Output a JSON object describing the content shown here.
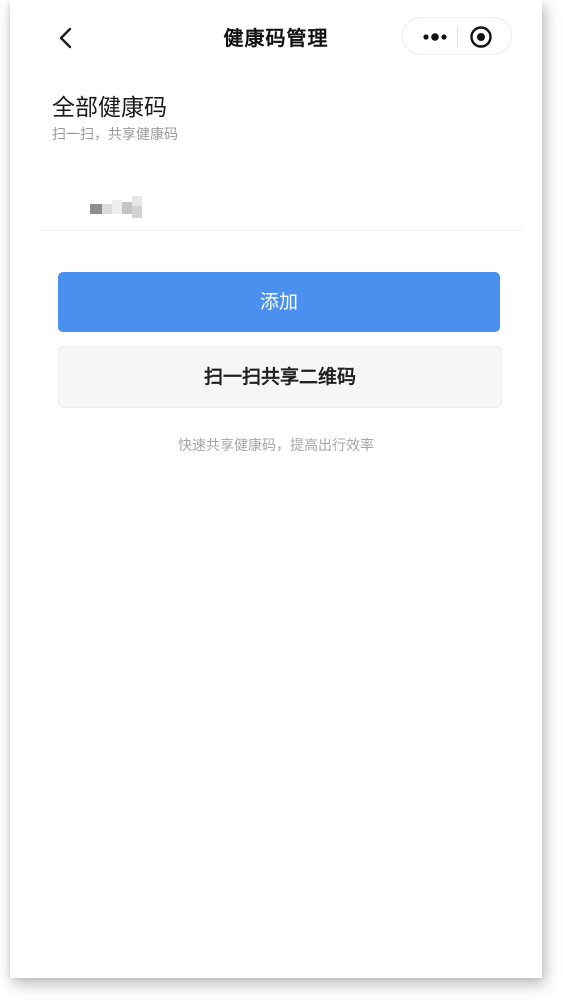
{
  "nav": {
    "title": "健康码管理",
    "back_icon": "chevron-left-icon",
    "more_icon": "more-dots-icon",
    "close_icon": "target-circle-icon"
  },
  "section": {
    "title": "全部健康码",
    "subtitle": "扫一扫，共享健康码"
  },
  "list": {
    "items": [
      {
        "label_state": "pixelated"
      }
    ]
  },
  "actions": {
    "add_label": "添加",
    "scan_share_label": "扫一扫共享二维码"
  },
  "tip": "快速共享健康码，提高出行效率",
  "colors": {
    "primary": "#4a90ef",
    "secondary_bg": "#f6f6f6",
    "title_text": "#111111",
    "muted_text": "#9a9a9a"
  }
}
